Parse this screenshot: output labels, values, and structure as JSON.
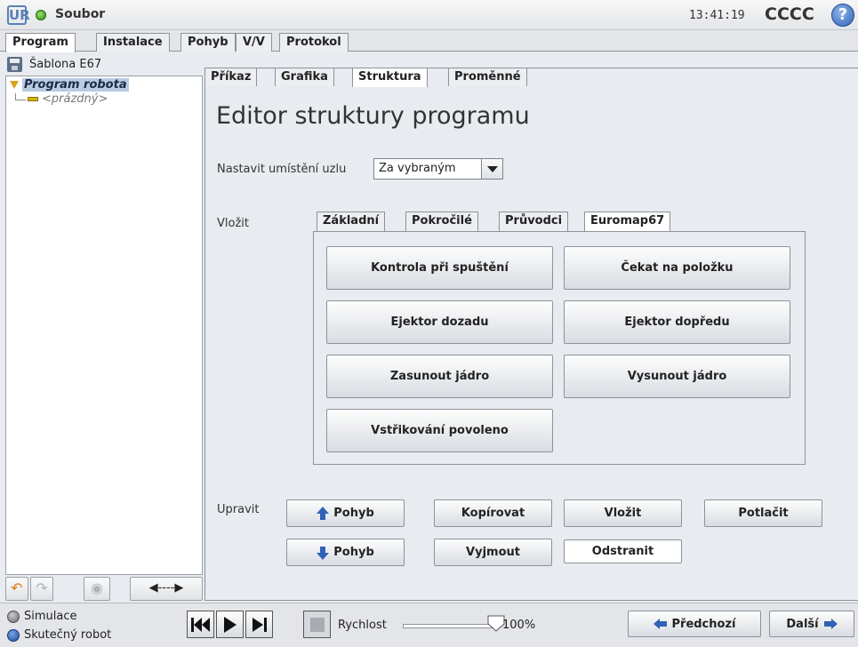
{
  "titlebar": {
    "logo": "UR",
    "app_title": "Soubor",
    "time": "13:41:19",
    "robot_name": "CCCC",
    "help": "?"
  },
  "main_tabs": [
    "Program",
    "Instalace",
    "Pohyb",
    "V/V",
    "Protokol"
  ],
  "left": {
    "file_name": "Šablona E67",
    "tree_root": "Program robota",
    "tree_child": "<prázdný>"
  },
  "sub_tabs": [
    "Příkaz",
    "Grafika",
    "Struktura",
    "Proměnné"
  ],
  "editor": {
    "title": "Editor struktury programu",
    "placement_label": "Nastavit umístění uzlu",
    "placement_value": "Za vybraným",
    "insert_label": "Vložit",
    "insert_tabs": [
      "Základní",
      "Pokročilé",
      "Průvodci",
      "Euromap67"
    ],
    "insert_buttons": [
      "Kontrola při spuštění",
      "Čekat na položku",
      "Ejektor dozadu",
      "Ejektor dopředu",
      "Zasunout jádro",
      "Vysunout jádro",
      "Vstřikování povoleno"
    ],
    "edit_label": "Upravit",
    "edit": {
      "move_up": "Pohyb",
      "copy": "Kopírovat",
      "paste": "Vložit",
      "suppress": "Potlačit",
      "move_down": "Pohyb",
      "cut": "Vyjmout",
      "delete": "Odstranit"
    }
  },
  "bottom": {
    "simulation": "Simulace",
    "real_robot": "Skutečný robot",
    "speed_label": "Rychlost",
    "speed_value": "100%",
    "speed_fraction": 1.0,
    "prev": "Předchozí",
    "next": "Další"
  },
  "colors": {
    "accent_blue": "#2f62b6",
    "status_green": "#2f8a13",
    "selection": "#b8cbe3"
  }
}
